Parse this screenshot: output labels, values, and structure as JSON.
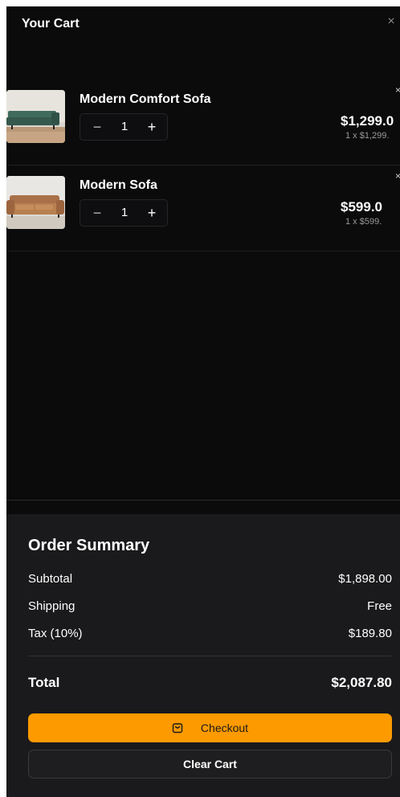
{
  "header": {
    "title": "Your Cart",
    "close_glyph": "×"
  },
  "items": [
    {
      "name": "Modern Comfort Sofa",
      "quantity": "1",
      "price": "$1,299.0",
      "unit_price": "1 x $1,299.",
      "minus_glyph": "−",
      "plus_glyph": "+",
      "remove_glyph": "×",
      "image": "green-sofa"
    },
    {
      "name": "Modern Sofa",
      "quantity": "1",
      "price": "$599.0",
      "unit_price": "1 x $599.",
      "minus_glyph": "−",
      "plus_glyph": "+",
      "remove_glyph": "×",
      "image": "tan-leather-sofa"
    }
  ],
  "summary": {
    "title": "Order Summary",
    "rows": [
      {
        "label": "Subtotal",
        "value": "$1,898.00"
      },
      {
        "label": "Shipping",
        "value": "Free"
      },
      {
        "label": "Tax (10%)",
        "value": "$189.80"
      }
    ],
    "total_label": "Total",
    "total_value": "$2,087.80"
  },
  "actions": {
    "checkout_label": "Checkout",
    "checkout_icon": "shopping-bag-icon",
    "clear_label": "Clear Cart"
  },
  "colors": {
    "background": "#0b0b0c",
    "summary_panel": "#1a1a1c",
    "accent": "#fd9a00"
  }
}
